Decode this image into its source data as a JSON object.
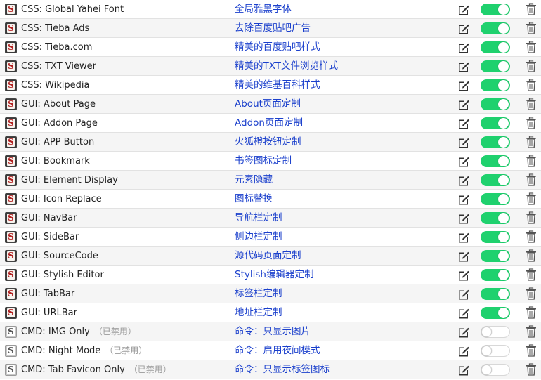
{
  "disabled_label": "（已禁用）",
  "colors": {
    "toggle_on": "#1fd16e",
    "description_text": "#1a3fcc",
    "disabled_text": "#9a9a9a"
  },
  "icons": {
    "script": "stylish-s-icon",
    "edit": "edit-icon",
    "delete": "trash-icon"
  },
  "scripts": [
    {
      "name": "CSS: Global Yahei Font",
      "description": "全局雅黑字体",
      "enabled": true
    },
    {
      "name": "CSS: Tieba Ads",
      "description": "去除百度贴吧广告",
      "enabled": true
    },
    {
      "name": "CSS: Tieba.com",
      "description": "精美的百度贴吧样式",
      "enabled": true
    },
    {
      "name": "CSS: TXT Viewer",
      "description": "精美的TXT文件浏览样式",
      "enabled": true
    },
    {
      "name": "CSS: Wikipedia",
      "description": "精美的维基百科样式",
      "enabled": true
    },
    {
      "name": "GUI: About Page",
      "description": "About页面定制",
      "enabled": true
    },
    {
      "name": "GUI: Addon Page",
      "description": "Addon页面定制",
      "enabled": true
    },
    {
      "name": "GUI: APP Button",
      "description": "火狐橙按钮定制",
      "enabled": true
    },
    {
      "name": "GUI: Bookmark",
      "description": "书签图标定制",
      "enabled": true
    },
    {
      "name": "GUI: Element Display",
      "description": "元素隐藏",
      "enabled": true
    },
    {
      "name": "GUI: Icon Replace",
      "description": "图标替换",
      "enabled": true
    },
    {
      "name": "GUI: NavBar",
      "description": "导航栏定制",
      "enabled": true
    },
    {
      "name": "GUI: SideBar",
      "description": "侧边栏定制",
      "enabled": true
    },
    {
      "name": "GUI: SourceCode",
      "description": "源代码页面定制",
      "enabled": true
    },
    {
      "name": "GUI: Stylish Editor",
      "description": "Stylish编辑器定制",
      "enabled": true
    },
    {
      "name": "GUI: TabBar",
      "description": "标签栏定制",
      "enabled": true
    },
    {
      "name": "GUI: URLBar",
      "description": "地址栏定制",
      "enabled": true
    },
    {
      "name": "CMD: IMG Only",
      "description": "命令：只显示图片",
      "enabled": false
    },
    {
      "name": "CMD: Night Mode",
      "description": "命令：启用夜间模式",
      "enabled": false
    },
    {
      "name": "CMD: Tab Favicon Only",
      "description": "命令：只显示标签图标",
      "enabled": false
    }
  ]
}
